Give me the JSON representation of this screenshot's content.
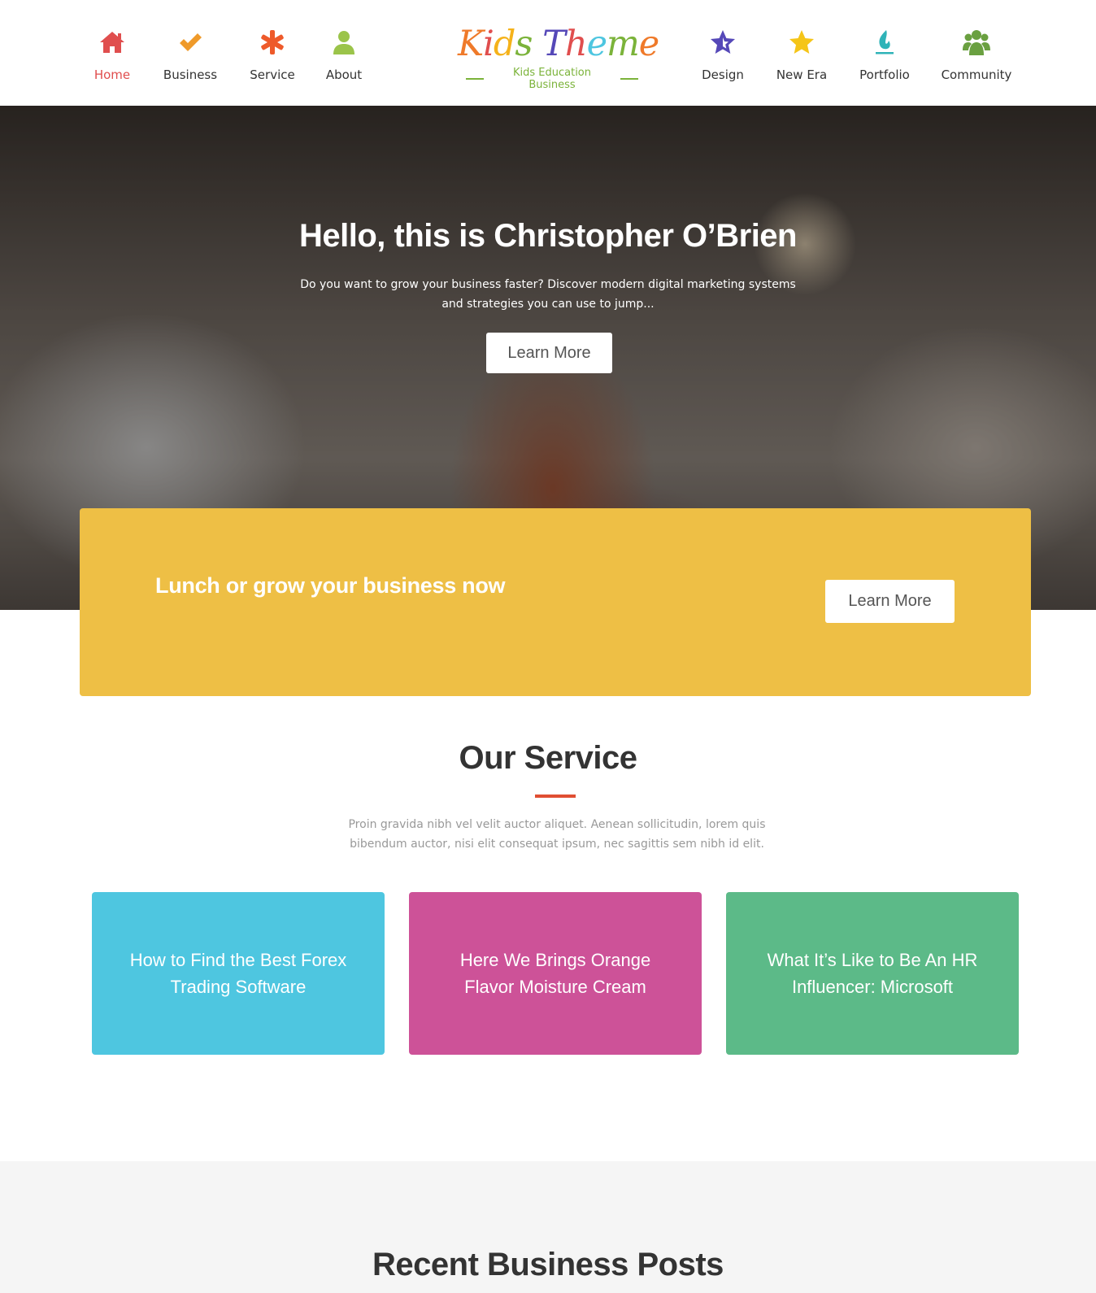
{
  "nav_left": [
    {
      "label": "Home",
      "icon": "home-icon",
      "color": "#e04e4e",
      "active": true
    },
    {
      "label": "Business",
      "icon": "check-icon",
      "color": "#ef9a2a"
    },
    {
      "label": "Service",
      "icon": "asterisk-icon",
      "color": "#ee5a2a"
    },
    {
      "label": "About",
      "icon": "user-icon",
      "color": "#9bc44a"
    }
  ],
  "nav_right": [
    {
      "label": "Design",
      "icon": "star-outline-icon",
      "color": "#5548b8"
    },
    {
      "label": "New Era",
      "icon": "star-icon",
      "color": "#f5c518"
    },
    {
      "label": "Portfolio",
      "icon": "flame-icon",
      "color": "#2fb3b8"
    },
    {
      "label": "Community",
      "icon": "users-icon",
      "color": "#6aa040"
    }
  ],
  "logo": {
    "title": "Kids Theme",
    "subtitle": "Kids Education Business"
  },
  "hero": {
    "title": "Hello, this is Christopher O’Brien",
    "text": "Do you want to grow your business faster? Discover modern digital marketing systems and strategies you can use to jump...",
    "button": "Learn More"
  },
  "cta": {
    "title": "Lunch or grow your business now",
    "button": "Learn More",
    "color": "#eebf45"
  },
  "service": {
    "title": "Our Service",
    "text": "Proin gravida nibh vel velit auctor aliquet. Aenean sollicitudin, lorem quis bibendum auctor, nisi elit consequat ipsum, nec sagittis sem nibh id elit.",
    "cards": [
      {
        "title": "How to Find the Best Forex Trading Software",
        "color": "#4ec6e0"
      },
      {
        "title": "Here We Brings Orange Flavor Moisture Cream",
        "color": "#cd5298"
      },
      {
        "title": "What It’s Like to Be An HR Influencer: Microsoft",
        "color": "#5cba88"
      }
    ]
  },
  "recent": {
    "title": "Recent Business Posts"
  }
}
